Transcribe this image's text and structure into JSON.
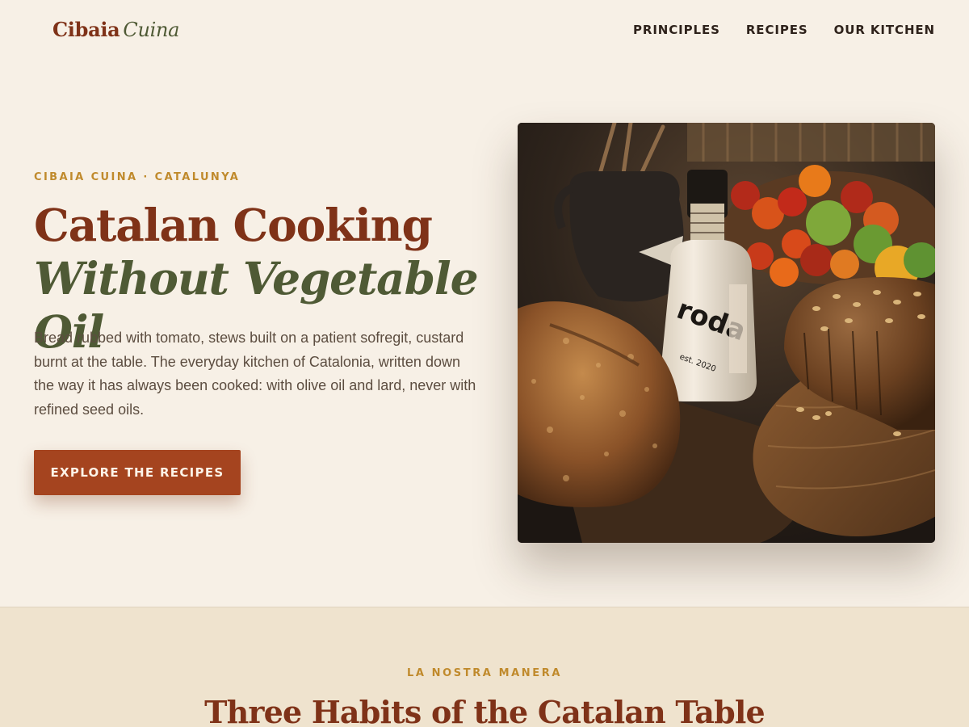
{
  "header": {
    "brand_main": "Cibaia",
    "brand_sub": "Cuina",
    "nav": [
      {
        "label": "PRINCIPLES"
      },
      {
        "label": "RECIPES"
      },
      {
        "label": "OUR KITCHEN"
      }
    ]
  },
  "hero": {
    "eyebrow": "CIBAIA CUINA · CATALUNYA",
    "title_line1": "Catalan Cooking",
    "title_line2": "Without Vegetable Oil",
    "body": "Bread rubbed with tomato, stews built on a patient sofregit, custard burnt at the table. The everyday kitchen of Catalonia, written down the way it has always been cooked: with olive oil and lard, never with refined seed oils.",
    "cta_label": "EXPLORE THE RECIPES",
    "image": {
      "bottle_label": "roda",
      "bottle_sub": "est. 2020"
    }
  },
  "section": {
    "eyebrow": "LA NOSTRA MANERA",
    "title": "Three Habits of the Catalan Table"
  },
  "colors": {
    "background": "#f7f0e6",
    "section_background": "#efe3ce",
    "brand_red": "#7f3218",
    "olive": "#4f5a35",
    "gold": "#c08a2c",
    "cta": "#a5441f"
  },
  "icons": {
    "hero_image": "bread-olive-oil-tomatoes-photo"
  }
}
